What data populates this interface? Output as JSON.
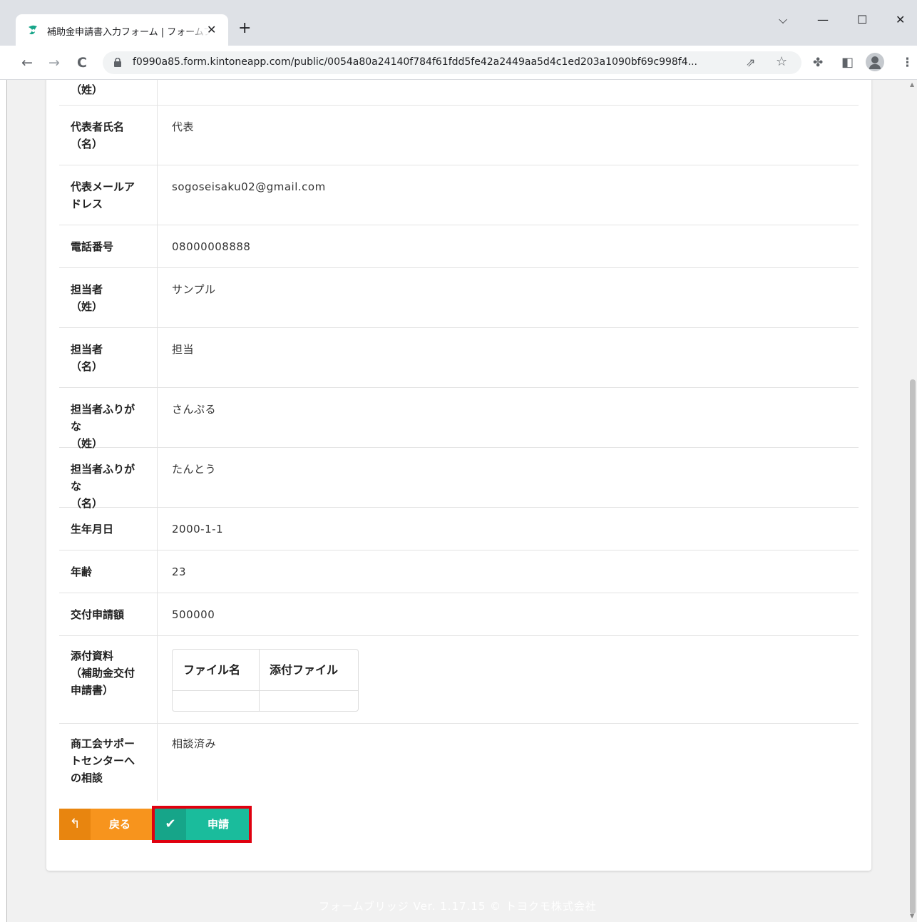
{
  "browser": {
    "tab_title": "補助金申請書入力フォーム | フォームブリッジ",
    "tab_close": "✕",
    "new_tab": "+",
    "url": "f0990a85.form.kintoneapp.com/public/0054a80a24140f784f61fdd5fe42a2449aa5d4c1ed203a1090bf69c998f4...",
    "window_controls": {
      "dropdown": "⌵",
      "minimize": "—",
      "maximize": "☐",
      "close": "✕"
    },
    "nav": {
      "back": "←",
      "forward": "→",
      "reload": "C"
    }
  },
  "form": {
    "top_partial_label": "（姓）",
    "rows": [
      {
        "label": "代表者氏名（名）",
        "value": "代表"
      },
      {
        "label": "代表メールアドレス",
        "value": "sogoseisaku02@gmail.com"
      },
      {
        "label": "電話番号",
        "value": "08000008888"
      },
      {
        "label": "担当者（姓）",
        "value": "サンプル"
      },
      {
        "label": "担当者（名）",
        "value": "担当"
      },
      {
        "label": "担当者ふりがな（姓）",
        "value": "さんぷる"
      },
      {
        "label": "担当者ふりがな（名）",
        "value": "たんとう"
      },
      {
        "label": "生年月日",
        "value": "2000-1-1"
      },
      {
        "label": "年齢",
        "value": "23"
      },
      {
        "label": "交付申請額",
        "value": "500000"
      }
    ],
    "attachment": {
      "label": "添付資料（補助金交付申請書）",
      "columns": [
        "ファイル名",
        "添付ファイル"
      ]
    },
    "consultation": {
      "label": "商工会サポートセンターへの相談",
      "value": "相談済み"
    }
  },
  "buttons": {
    "back_label": "戻る",
    "submit_label": "申請"
  },
  "footer_text": "フォームブリッジ Ver. 1.17.15 © トヨクモ株式会社",
  "colors": {
    "back_button": "#f7941d",
    "submit_button": "#1abc9c",
    "highlight_box": "#e0000f"
  }
}
